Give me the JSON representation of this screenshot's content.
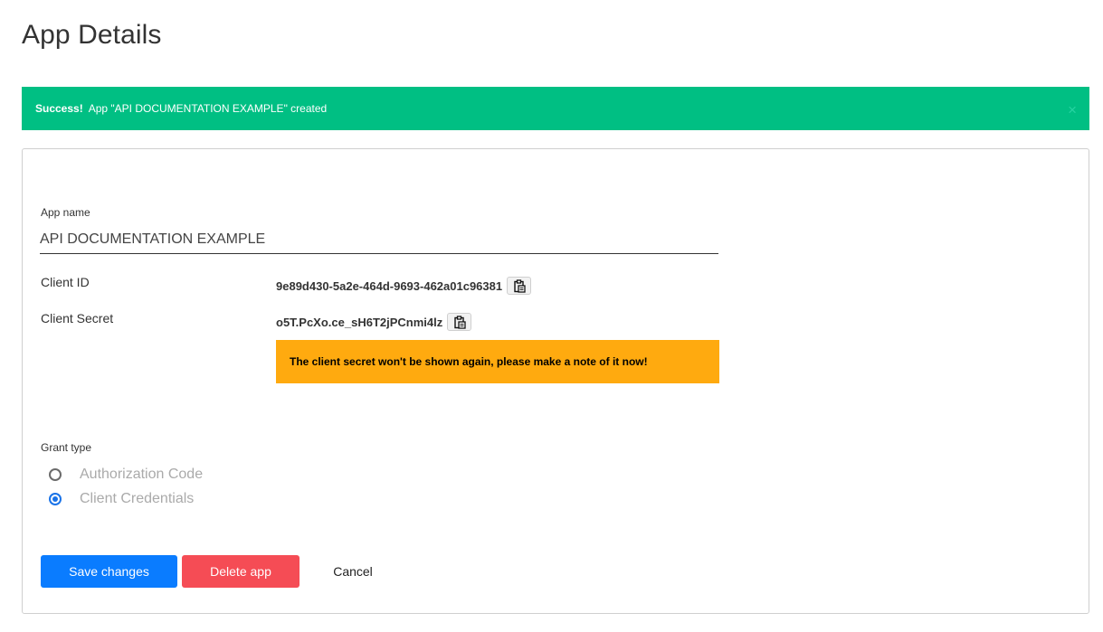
{
  "page": {
    "title": "App Details"
  },
  "alert": {
    "strong": "Success!",
    "message": "App \"API DOCUMENTATION EXAMPLE\" created",
    "close": "×",
    "color": "#00bf83"
  },
  "form": {
    "app_name_label": "App name",
    "app_name_value": "API DOCUMENTATION EXAMPLE",
    "client_id_label": "Client ID",
    "client_id_value": "9e89d430-5a2e-464d-9693-462a01c96381",
    "client_secret_label": "Client Secret",
    "client_secret_value": "o5T.PcXo.ce_sH6T2jPCnmi4lz",
    "secret_warning": "The client secret won't be shown again, please make a note of it now!",
    "grant_type_label": "Grant type",
    "grant_options": [
      {
        "label": "Authorization Code",
        "selected": false
      },
      {
        "label": "Client Credentials",
        "selected": true
      }
    ]
  },
  "actions": {
    "save": "Save changes",
    "delete": "Delete app",
    "cancel": "Cancel"
  },
  "colors": {
    "primary": "#0a7cff",
    "danger": "#f54c55",
    "warning": "#ffaa0f",
    "success": "#00bf83"
  },
  "icons": {
    "copy": "clipboard-icon",
    "close": "close-icon"
  }
}
